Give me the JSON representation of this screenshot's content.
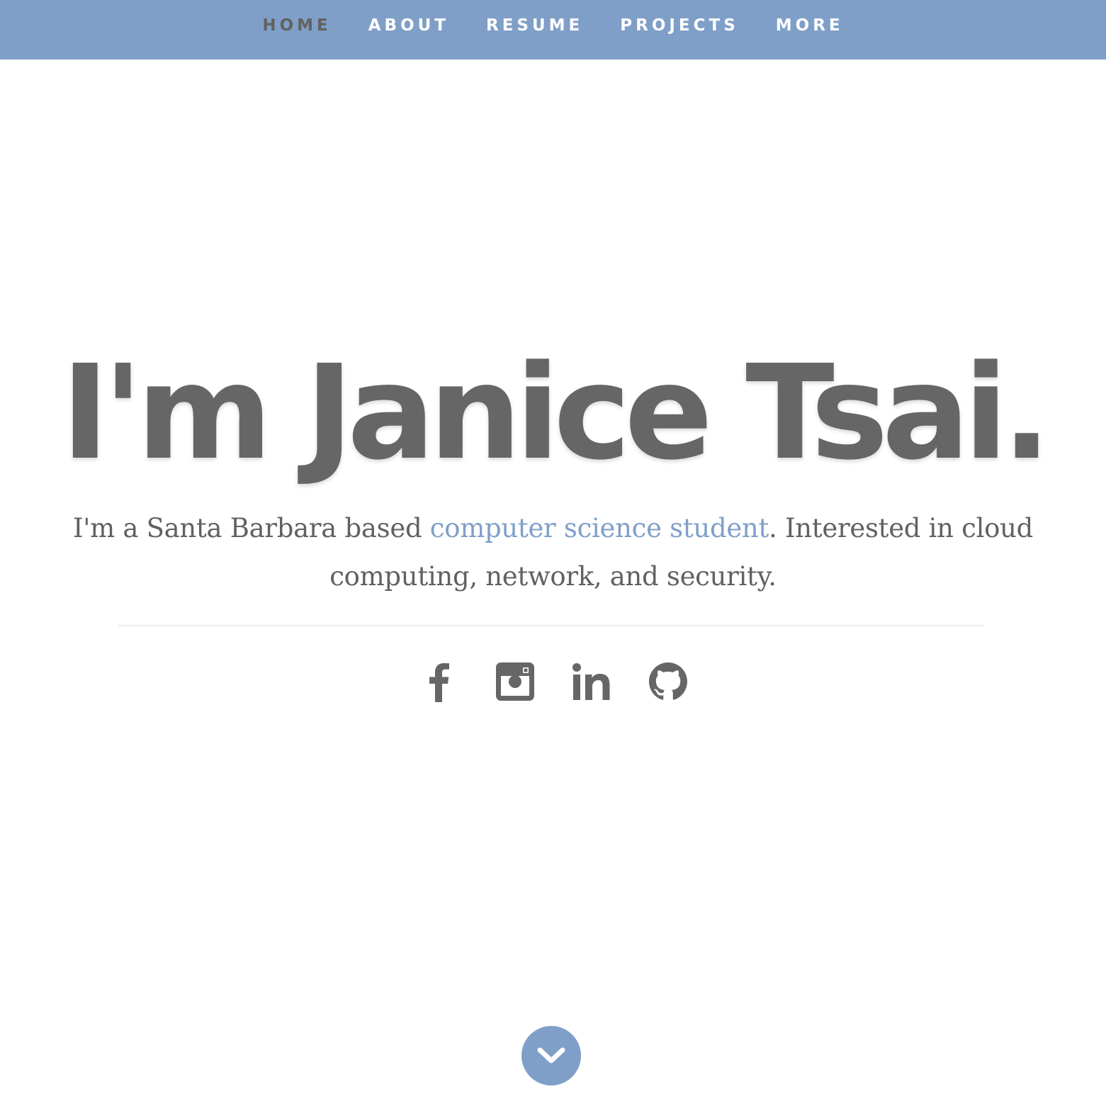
{
  "nav": {
    "items": [
      {
        "label": "HOME",
        "active": true
      },
      {
        "label": "ABOUT",
        "active": false
      },
      {
        "label": "RESUME",
        "active": false
      },
      {
        "label": "PROJECTS",
        "active": false
      },
      {
        "label": "MORE",
        "active": false
      }
    ]
  },
  "hero": {
    "title": "I'm Janice Tsai.",
    "desc_before": "I'm a Santa Barbara based ",
    "desc_link": "computer science student",
    "desc_after": ". Interested in cloud computing, network, and security."
  },
  "social": {
    "icons": [
      "facebook-icon",
      "instagram-icon",
      "linkedin-icon",
      "github-icon"
    ]
  },
  "scroll": {
    "icon": "chevron-down-icon"
  },
  "colors": {
    "accent": "#7f9fc8",
    "text": "#676667",
    "nav_active": "#626262",
    "background": "#ffffff"
  }
}
